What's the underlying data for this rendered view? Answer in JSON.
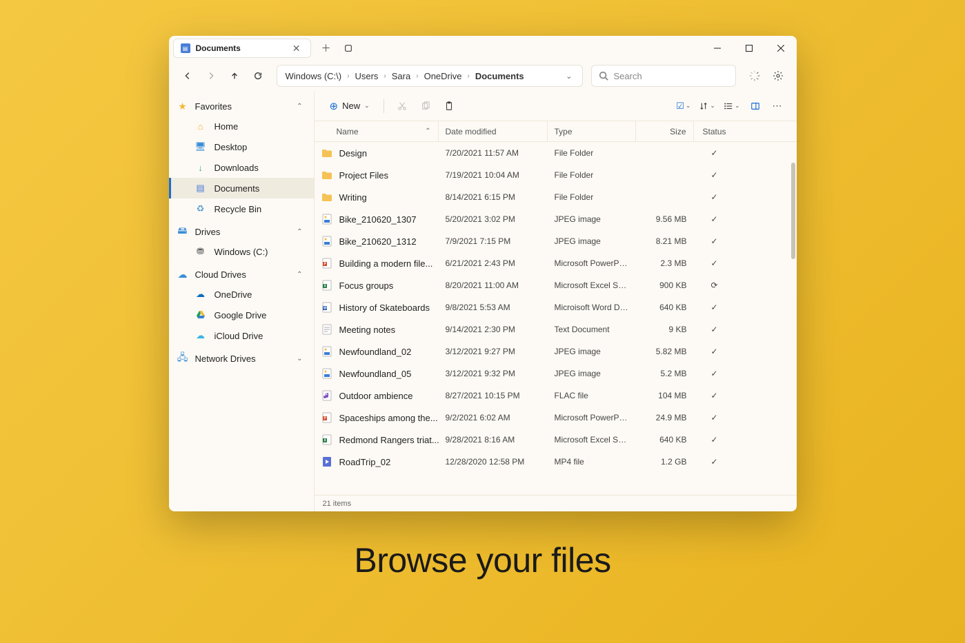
{
  "tab": {
    "title": "Documents"
  },
  "breadcrumb": {
    "items": [
      "Windows (C:\\)",
      "Users",
      "Sara",
      "OneDrive",
      "Documents"
    ]
  },
  "search": {
    "placeholder": "Search"
  },
  "toolbar": {
    "new_label": "New"
  },
  "sidebar": {
    "favorites_label": "Favorites",
    "favorites": [
      {
        "label": "Home",
        "icon": "home"
      },
      {
        "label": "Desktop",
        "icon": "desktop"
      },
      {
        "label": "Downloads",
        "icon": "downloads"
      },
      {
        "label": "Documents",
        "icon": "documents",
        "selected": true
      },
      {
        "label": "Recycle Bin",
        "icon": "recycle"
      }
    ],
    "drives_label": "Drives",
    "drives": [
      {
        "label": "Windows (C:)",
        "icon": "disk"
      }
    ],
    "cloud_label": "Cloud Drives",
    "cloud": [
      {
        "label": "OneDrive",
        "icon": "onedrive"
      },
      {
        "label": "Google Drive",
        "icon": "gdrive"
      },
      {
        "label": "iCloud Drive",
        "icon": "icloud"
      }
    ],
    "network_label": "Network Drives"
  },
  "columns": {
    "name": "Name",
    "date": "Date modified",
    "type": "Type",
    "size": "Size",
    "status": "Status"
  },
  "files": [
    {
      "name": "Design",
      "date": "7/20/2021  11:57 AM",
      "type": "File Folder",
      "size": "",
      "icon": "folder",
      "status": "check"
    },
    {
      "name": "Project Files",
      "date": "7/19/2021  10:04 AM",
      "type": "File Folder",
      "size": "",
      "icon": "folder",
      "status": "check"
    },
    {
      "name": "Writing",
      "date": "8/14/2021  6:15 PM",
      "type": "File Folder",
      "size": "",
      "icon": "folder",
      "status": "check"
    },
    {
      "name": "Bike_210620_1307",
      "date": "5/20/2021  3:02 PM",
      "type": "JPEG image",
      "size": "9.56 MB",
      "icon": "jpeg",
      "status": "check"
    },
    {
      "name": "Bike_210620_1312",
      "date": "7/9/2021  7:15 PM",
      "type": "JPEG image",
      "size": "8.21 MB",
      "icon": "jpeg",
      "status": "check"
    },
    {
      "name": "Building a modern file...",
      "date": "6/21/2021  2:43 PM",
      "type": "Microsoft PowerPoint...",
      "size": "2.3 MB",
      "icon": "ppt",
      "status": "check"
    },
    {
      "name": "Focus groups",
      "date": "8/20/2021  11:00 AM",
      "type": "Microsoft Excel Sprea...",
      "size": "900 KB",
      "icon": "xls",
      "status": "sync"
    },
    {
      "name": "History of Skateboards",
      "date": "9/8/2021  5:53 AM",
      "type": "Microisoft Word Doc...",
      "size": "640 KB",
      "icon": "doc",
      "status": "check"
    },
    {
      "name": "Meeting notes",
      "date": "9/14/2021  2:30 PM",
      "type": "Text Document",
      "size": "9 KB",
      "icon": "txt",
      "status": "check"
    },
    {
      "name": "Newfoundland_02",
      "date": "3/12/2021  9:27 PM",
      "type": "JPEG image",
      "size": "5.82 MB",
      "icon": "jpeg",
      "status": "check"
    },
    {
      "name": "Newfoundland_05",
      "date": "3/12/2021  9:32 PM",
      "type": "JPEG image",
      "size": "5.2 MB",
      "icon": "jpeg",
      "status": "check"
    },
    {
      "name": "Outdoor ambience",
      "date": "8/27/2021  10:15 PM",
      "type": "FLAC file",
      "size": "104 MB",
      "icon": "flac",
      "status": "check"
    },
    {
      "name": "Spaceships among the...",
      "date": "9/2/2021  6:02 AM",
      "type": "Microsoft PowerPoint...",
      "size": "24.9 MB",
      "icon": "ppt",
      "status": "check"
    },
    {
      "name": "Redmond Rangers triat...",
      "date": "9/28/2021  8:16 AM",
      "type": "Microsoft Excel Sprea...",
      "size": "640 KB",
      "icon": "xls",
      "status": "check"
    },
    {
      "name": "RoadTrip_02",
      "date": "12/28/2020  12:58 PM",
      "type": "MP4 file",
      "size": "1.2 GB",
      "icon": "mp4",
      "status": "check"
    }
  ],
  "statusbar": {
    "count": "21 items"
  },
  "caption": "Browse your files"
}
